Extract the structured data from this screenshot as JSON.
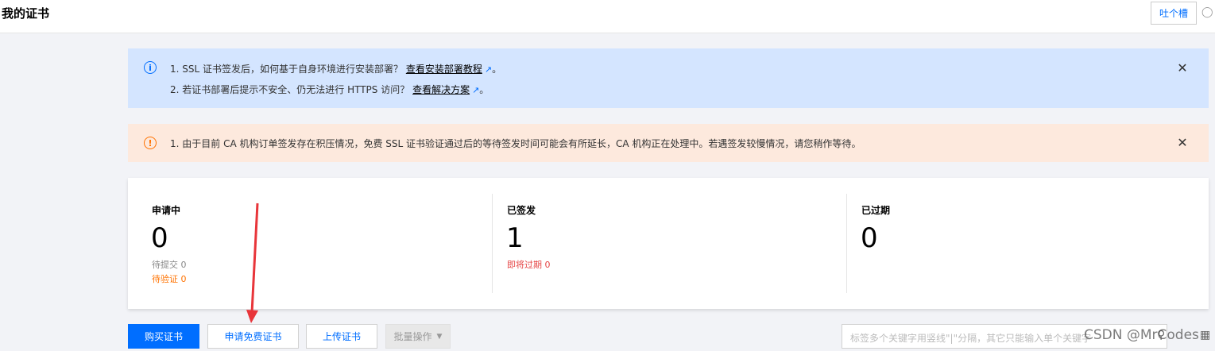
{
  "header": {
    "title": "我的证书",
    "feedback_label": "吐个槽"
  },
  "alerts": {
    "info": {
      "line1_text": "1. SSL 证书签发后，如何基于自身环境进行安装部署？",
      "line1_link": "查看安装部署教程",
      "line1_end": "。",
      "line2_text": "2. 若证书部署后提示不安全、仍无法进行 HTTPS 访问？",
      "line2_link": "查看解决方案",
      "line2_end": "。"
    },
    "warning": {
      "text": "1. 由于目前 CA 机构订单签发存在积压情况，免费 SSL 证书验证通过后的等待签发时间可能会有所延长，CA 机构正在处理中。若遇签发较慢情况，请您稍作等待。"
    }
  },
  "stats": {
    "pending": {
      "label": "申请中",
      "value": "0",
      "sub1": "待提交 0",
      "sub2": "待验证 0"
    },
    "issued": {
      "label": "已签发",
      "value": "1",
      "sub1": "即将过期 0"
    },
    "expired": {
      "label": "已过期",
      "value": "0"
    }
  },
  "toolbar": {
    "buy_label": "购买证书",
    "apply_free_label": "申请免费证书",
    "upload_label": "上传证书",
    "batch_label": "批量操作",
    "search_placeholder": "标签多个关键字用竖线\"|\"分隔，其它只能输入单个关键字"
  },
  "watermark": "CSDN @MrCodes",
  "colors": {
    "primary": "#006eff",
    "info_bg": "#d4e5ff",
    "warn_bg": "#fde9dd",
    "warn": "#ff7200",
    "danger": "#e54545",
    "arrow": "#e8353a"
  }
}
